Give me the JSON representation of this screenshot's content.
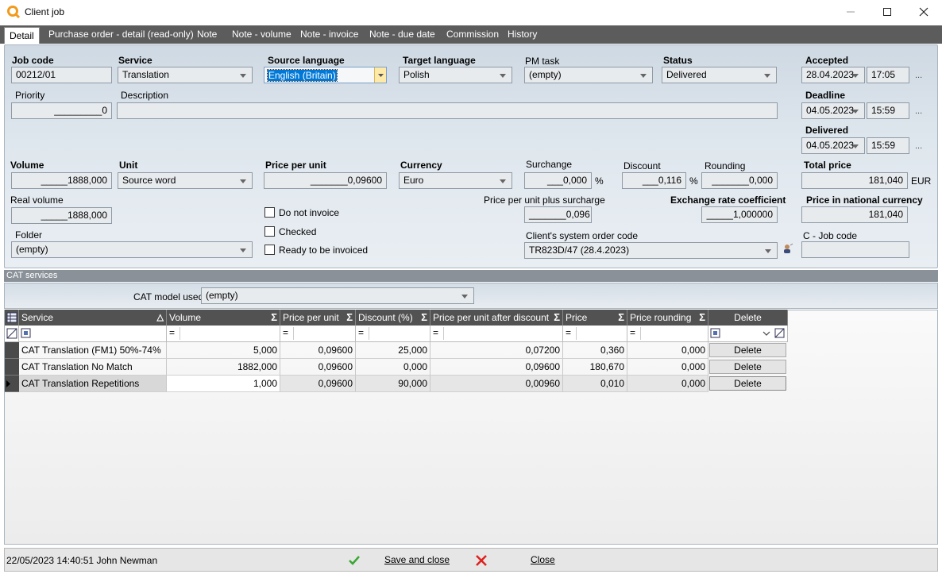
{
  "window": {
    "title": "Client job"
  },
  "tabs": [
    "Detail",
    "Purchase order - detail (read-only)",
    "Note",
    "Note - volume",
    "Note - invoice",
    "Note - due date",
    "Commission",
    "History"
  ],
  "form": {
    "job_code": {
      "label": "Job code",
      "value": "00212/01"
    },
    "service": {
      "label": "Service",
      "value": "Translation"
    },
    "source_language": {
      "label": "Source language",
      "value": "English (Britain)"
    },
    "target_language": {
      "label": "Target language",
      "value": "Polish"
    },
    "pm_task": {
      "label": "PM task",
      "value": "(empty)"
    },
    "status": {
      "label": "Status",
      "value": "Delivered"
    },
    "accepted": {
      "label": "Accepted",
      "date": "28.04.2023",
      "time": "17:05"
    },
    "priority": {
      "label": "Priority",
      "value": "_________0"
    },
    "description": {
      "label": "Description",
      "value": ""
    },
    "deadline": {
      "label": "Deadline",
      "date": "04.05.2023",
      "time": "15:59"
    },
    "delivered": {
      "label": "Delivered",
      "date": "04.05.2023",
      "time": "15:59"
    },
    "volume": {
      "label": "Volume",
      "value": "_____1888,000"
    },
    "unit": {
      "label": "Unit",
      "value": "Source word"
    },
    "price_per_unit": {
      "label": "Price per unit",
      "value": "_______0,09600"
    },
    "currency": {
      "label": "Currency",
      "value": "Euro"
    },
    "surcharge": {
      "label": "Surchange",
      "value": "___0,000",
      "unit": "%"
    },
    "discount": {
      "label": "Discount",
      "value": "___0,116",
      "unit": "%"
    },
    "rounding": {
      "label": "Rounding",
      "value": "_______0,000"
    },
    "total_price": {
      "label": "Total price",
      "value": "181,040",
      "currency": "EUR"
    },
    "real_volume": {
      "label": "Real volume",
      "value": "_____1888,000"
    },
    "price_plus_surcharge": {
      "label": "Price per unit plus surcharge",
      "value": "_______0,096"
    },
    "exchange_rate": {
      "label": "Exchange rate coefficient",
      "value": "_____1,000000"
    },
    "price_national": {
      "label": "Price in national currency",
      "value": "181,040"
    },
    "do_not_invoice": "Do not invoice",
    "checked": "Checked",
    "ready_to_invoice": "Ready to be invoiced",
    "folder": {
      "label": "Folder",
      "value": "(empty)"
    },
    "client_order_code": {
      "label": "Client's system order code",
      "value": "TR823D/47 (28.4.2023)"
    },
    "c_job_code": {
      "label": "C - Job code",
      "value": ""
    },
    "ellipsis": "..."
  },
  "cat": {
    "section_title": "CAT services",
    "model_label": "CAT model used:",
    "model_value": "(empty)",
    "columns": [
      "Service",
      "Volume",
      "Price per unit",
      "Discount (%)",
      "Price per unit after discount",
      "Price",
      "Price rounding",
      "Delete"
    ],
    "filter_symbol": "=",
    "rows": [
      {
        "service": "CAT  Translation (FM1) 50%-74%",
        "volume": "5,000",
        "ppu": "0,09600",
        "discount": "25,000",
        "ppu_after": "0,07200",
        "price": "0,360",
        "rounding": "0,000",
        "delete": "Delete"
      },
      {
        "service": "CAT  Translation No Match",
        "volume": "1882,000",
        "ppu": "0,09600",
        "discount": "0,000",
        "ppu_after": "0,09600",
        "price": "180,670",
        "rounding": "0,000",
        "delete": "Delete"
      },
      {
        "service": "CAT  Translation Repetitions",
        "volume": "1,000",
        "ppu": "0,09600",
        "discount": "90,000",
        "ppu_after": "0,00960",
        "price": "0,010",
        "rounding": "0,000",
        "delete": "Delete"
      }
    ]
  },
  "status": {
    "text": "22/05/2023 14:40:51 John Newman",
    "save_label": "Save and close",
    "close_label": "Close"
  },
  "colors": {
    "tabbar": "#5c5c5c",
    "accent_check": "#3aa832",
    "cancel_x": "#e02020"
  }
}
